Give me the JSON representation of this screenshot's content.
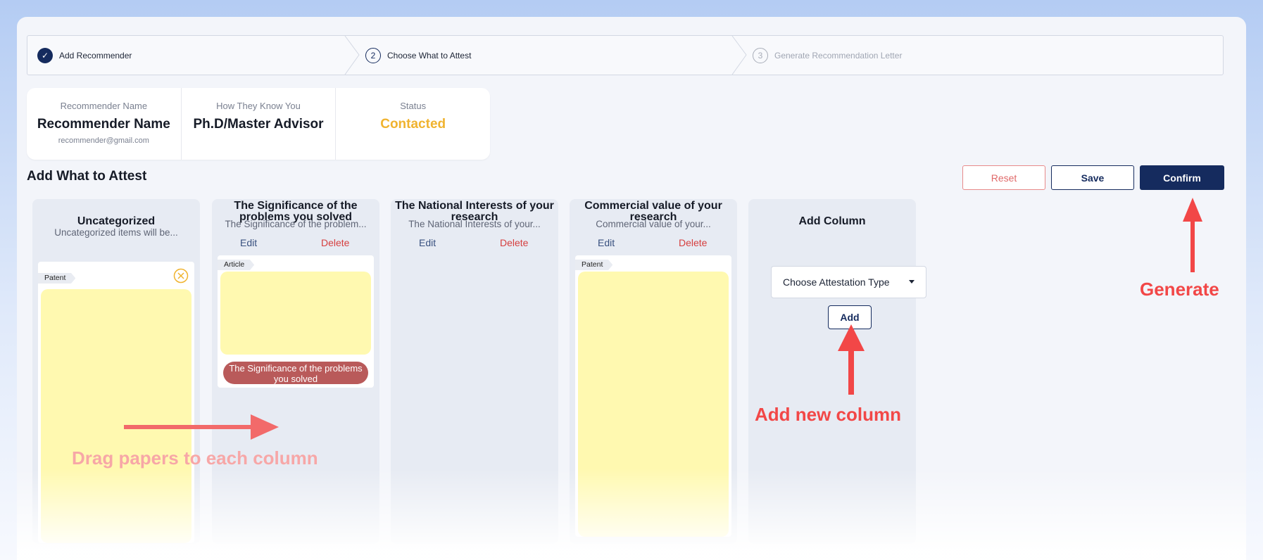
{
  "stepper": {
    "steps": [
      {
        "num": "✓",
        "label": "Add Recommender",
        "state": "done"
      },
      {
        "num": "2",
        "label": "Choose What to Attest",
        "state": "active"
      },
      {
        "num": "3",
        "label": "Generate Recommendation Letter",
        "state": "todo"
      }
    ]
  },
  "recommender": {
    "name_label": "Recommender Name",
    "name": "Recommender Name",
    "email": "recommender@gmail.com",
    "relation_label": "How They Know You",
    "relation": "Ph.D/Master Advisor",
    "status_label": "Status",
    "status": "Contacted"
  },
  "section_title": "Add What to Attest",
  "actions": {
    "reset": "Reset",
    "save": "Save",
    "confirm": "Confirm"
  },
  "columns": [
    {
      "title": "Uncategorized",
      "desc": "Uncategorized items will be...",
      "cards": [
        {
          "tag": "Patent"
        }
      ]
    },
    {
      "title": "The Significance of the problems you solved",
      "desc": "The Significance of the problem...",
      "edit": "Edit",
      "delete": "Delete",
      "cards": [
        {
          "tag": "Article",
          "pill": "The Significance of the problems you solved"
        }
      ]
    },
    {
      "title": "The National Interests of your research",
      "desc": "The National Interests of your...",
      "edit": "Edit",
      "delete": "Delete",
      "cards": []
    },
    {
      "title": "Commercial value of your research",
      "desc": "Commercial value of your...",
      "edit": "Edit",
      "delete": "Delete",
      "cards": [
        {
          "tag": "Patent"
        }
      ]
    }
  ],
  "add_column": {
    "title": "Add Column",
    "select_value": "Choose Attestation Type",
    "add_label": "Add"
  },
  "annotations": {
    "generate": "Generate",
    "add_new_column": "Add new column",
    "drag": "Drag papers to each column"
  },
  "colors": {
    "primary": "#152b5e",
    "status": "#f0b32f",
    "annotation": "#f24747",
    "paper": "#fff9b0"
  }
}
